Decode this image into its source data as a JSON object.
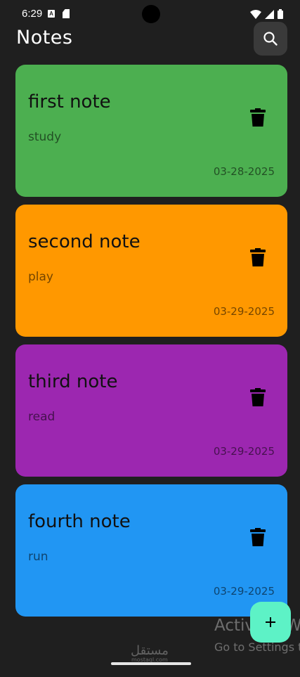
{
  "status_bar": {
    "time": "6:29",
    "notification_a": "A"
  },
  "header": {
    "title": "Notes",
    "search_icon": "search-icon"
  },
  "notes": [
    {
      "title": "first note",
      "content": "study",
      "date": "03-28-2025",
      "color": "#4caf50"
    },
    {
      "title": "second note",
      "content": "play",
      "date": "03-29-2025",
      "color": "#ff9800"
    },
    {
      "title": "third note",
      "content": "read",
      "date": "03-29-2025",
      "color": "#9c27b0"
    },
    {
      "title": "fourth note",
      "content": "run",
      "date": "03-29-2025",
      "color": "#2196f3"
    }
  ],
  "fab": {
    "icon": "plus-icon",
    "label": "+",
    "color": "#5df2c6"
  },
  "overlay": {
    "activate_title": "Activate Wi",
    "activate_sub": "Go to Settings t",
    "watermark": "مستقل",
    "watermark_sub": "mostaql.com"
  }
}
